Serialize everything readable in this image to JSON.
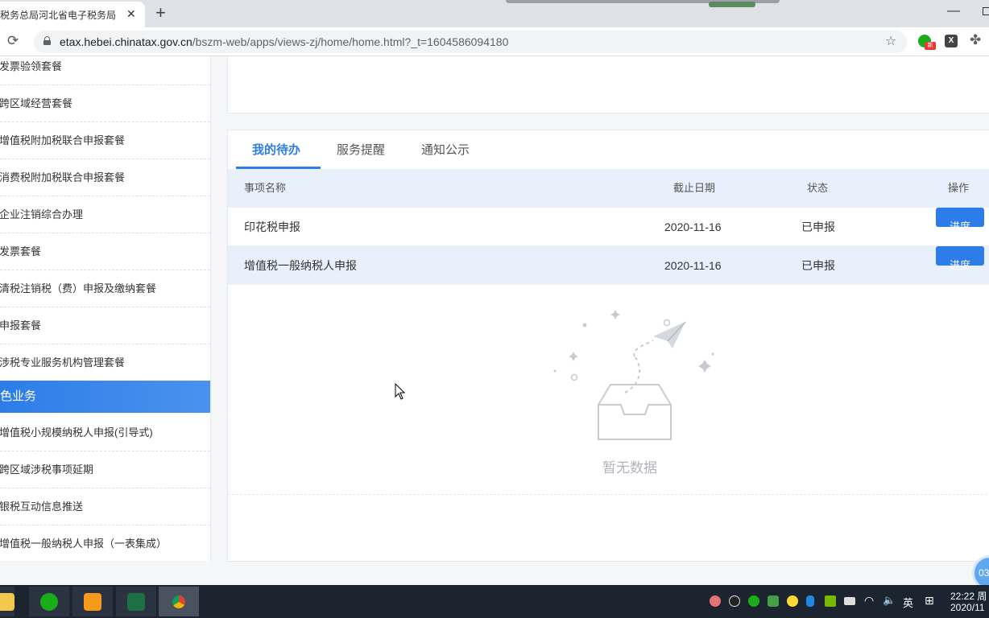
{
  "browser": {
    "tab_title": "税务总局河北省电子税务局",
    "tab_close": "✕",
    "new_tab": "+",
    "url_host": "etax.hebei.chinatax.gov.cn",
    "url_path": "/bszm-web/apps/views-zj/home/home.html?_t=1604586094180",
    "ext_badge": "新",
    "ext2_label": "X"
  },
  "sidebar": {
    "items_top": [
      "发票验领套餐",
      "跨区域经营套餐",
      "增值税附加税联合申报套餐",
      "消费税附加税联合申报套餐",
      "企业注销综合办理",
      "发票套餐",
      "清税注销税（费）申报及缴纳套餐",
      "申报套餐",
      "涉税专业服务机构管理套餐"
    ],
    "section_title": "色业务",
    "items_bottom": [
      "增值税小规模纳税人申报(引导式)",
      "跨区域涉税事项延期",
      "银税互动信息推送",
      "增值税一般纳税人申报（一表集成）"
    ]
  },
  "panel": {
    "tabs": [
      "我的待办",
      "服务提醒",
      "通知公示"
    ],
    "columns": {
      "name": "事项名称",
      "deadline": "截止日期",
      "status": "状态",
      "action": "操作"
    },
    "rows": [
      {
        "name": "印花税申报",
        "deadline": "2020-11-16",
        "status": "已申报",
        "action": "进度"
      },
      {
        "name": "增值税一般纳税人申报",
        "deadline": "2020-11-16",
        "status": "已申报",
        "action": "进度"
      }
    ],
    "empty_text": "暂无数据",
    "float_label": "03"
  },
  "taskbar": {
    "ime": "英",
    "time": "22:22 周",
    "date": "2020/11"
  },
  "colors": {
    "primary": "#2d7de8",
    "row_highlight": "#e8f1fb",
    "taskbar": "#1c2430"
  }
}
